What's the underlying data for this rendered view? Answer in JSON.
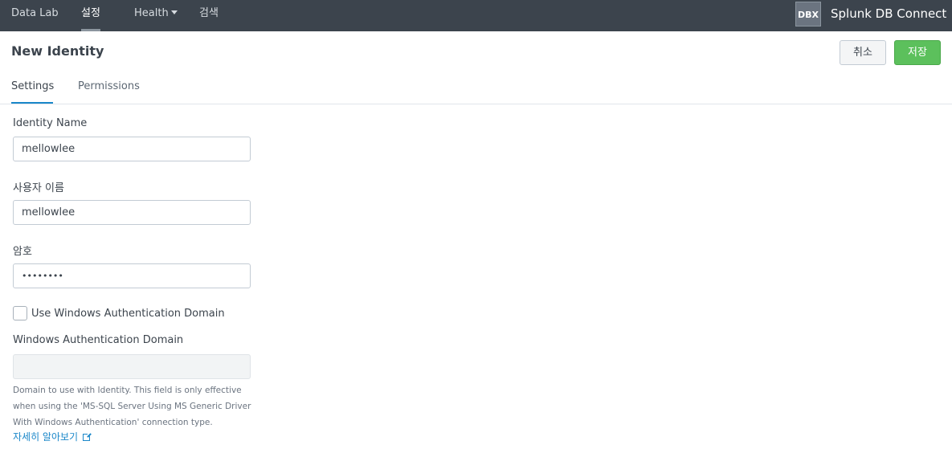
{
  "nav": {
    "items": [
      {
        "label": "Data Lab"
      },
      {
        "label": "설정"
      },
      {
        "label": "Health"
      },
      {
        "label": "검색"
      }
    ],
    "logo": "DBX",
    "app_title": "Splunk DB Connect"
  },
  "header": {
    "title": "New Identity",
    "cancel_label": "취소",
    "save_label": "저장"
  },
  "tabs": [
    {
      "label": "Settings"
    },
    {
      "label": "Permissions"
    }
  ],
  "form": {
    "identity_name": {
      "label": "Identity Name",
      "value": "mellowlee"
    },
    "username": {
      "label": "사용자 이름",
      "value": "mellowlee"
    },
    "password": {
      "label": "암호",
      "value": "••••••••"
    },
    "use_windows_auth": {
      "label": "Use Windows Authentication Domain",
      "checked": false
    },
    "windows_domain": {
      "label": "Windows Authentication Domain",
      "value": "",
      "help_text": "Domain to use with Identity. This field is only effective when using the 'MS-SQL Server Using MS Generic Driver With Windows Authentication' connection type.",
      "learn_more": "자세히 알아보기"
    }
  },
  "colors": {
    "nav_bg": "#3c444d",
    "save_button": "#5cc05c",
    "active_tab": "#1a87c9",
    "link": "#1a87c9"
  }
}
